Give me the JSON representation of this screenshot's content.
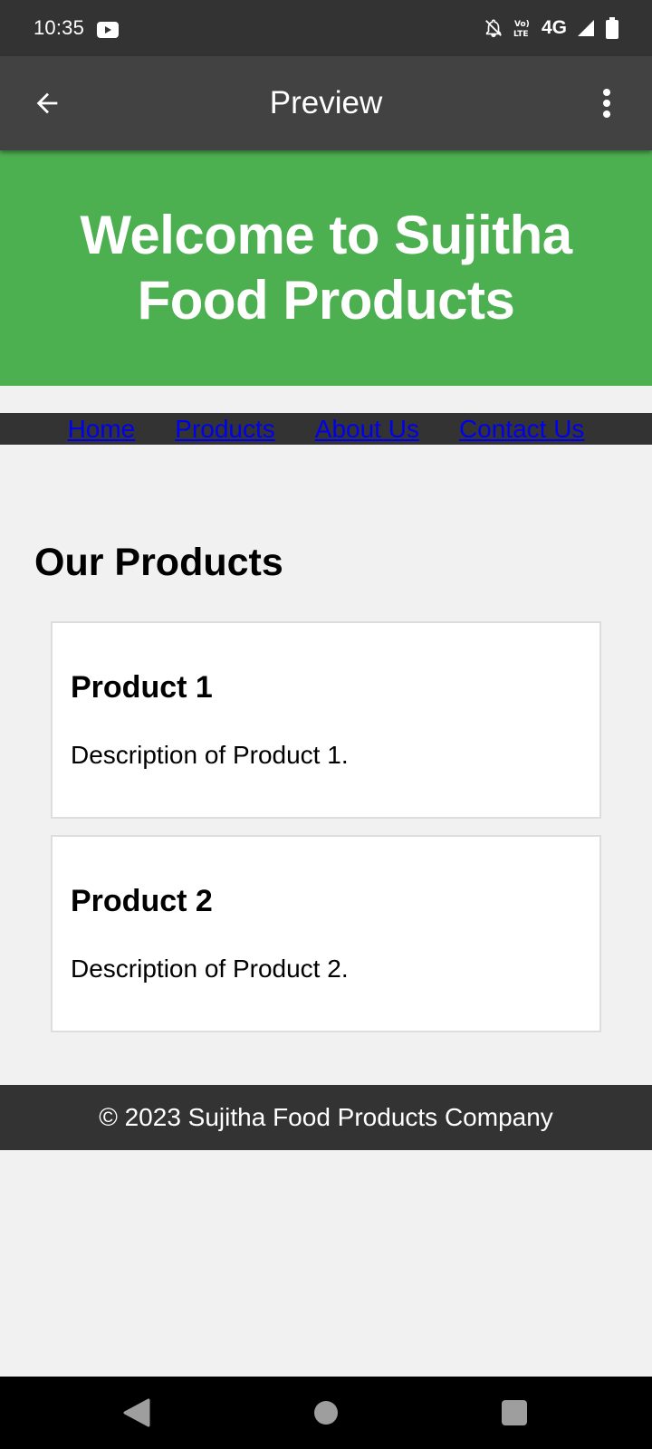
{
  "status_bar": {
    "time": "10:35",
    "network": "4G",
    "icons": [
      "youtube-icon",
      "bell-off-icon",
      "volte-icon",
      "signal-icon",
      "battery-icon"
    ]
  },
  "app_bar": {
    "title": "Preview",
    "icons": [
      "back-arrow-icon",
      "more-vert-icon"
    ]
  },
  "header": {
    "title": "Welcome to Sujitha Food Products",
    "background_color": "#4caf50"
  },
  "nav": {
    "links": [
      "Home",
      "Products",
      "About Us",
      "Contact Us"
    ],
    "link_color": "#0000ee"
  },
  "products": {
    "title": "Our Products",
    "items": [
      {
        "name": "Product 1",
        "description": "Description of Product 1."
      },
      {
        "name": "Product 2",
        "description": "Description of Product 2."
      }
    ]
  },
  "footer": {
    "text": "© 2023 Sujitha Food Products Company"
  },
  "system_nav": {
    "icons": [
      "nav-back-icon",
      "nav-home-icon",
      "nav-recents-icon"
    ]
  }
}
